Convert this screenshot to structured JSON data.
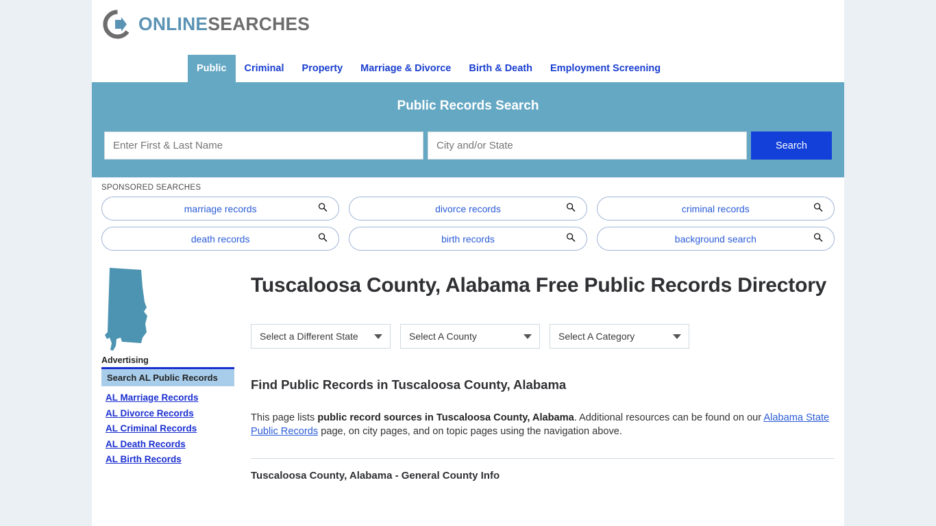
{
  "site": {
    "logo_online": "ONLINE",
    "logo_searches": "SEARCHES",
    "logo_icon": "circle-arrow-logo-icon"
  },
  "nav": {
    "items": [
      {
        "label": "Public",
        "active": true
      },
      {
        "label": "Criminal",
        "active": false
      },
      {
        "label": "Property",
        "active": false
      },
      {
        "label": "Marriage & Divorce",
        "active": false
      },
      {
        "label": "Birth & Death",
        "active": false
      },
      {
        "label": "Employment Screening",
        "active": false
      }
    ]
  },
  "hero": {
    "title": "Public Records Search",
    "name_placeholder": "Enter First & Last Name",
    "name_value": "",
    "location_placeholder": "City and/or State",
    "location_value": "",
    "search_button": "Search",
    "bg_color": "#65a8c3",
    "button_color": "#1240d9"
  },
  "sponsored": {
    "label": "SPONSORED SEARCHES",
    "rows": [
      [
        {
          "label": "marriage records",
          "icon": "search-icon"
        },
        {
          "label": "divorce records",
          "icon": "search-icon"
        },
        {
          "label": "criminal records",
          "icon": "search-icon"
        }
      ],
      [
        {
          "label": "death records",
          "icon": "search-icon"
        },
        {
          "label": "birth records",
          "icon": "search-icon"
        },
        {
          "label": "background search",
          "icon": "search-icon"
        }
      ]
    ]
  },
  "main": {
    "state_map_icon": "alabama-state-map-icon",
    "page_title": "Tuscaloosa County, Alabama Free Public Records Directory",
    "selects": {
      "state": "Select a Different State",
      "county": "Select A County",
      "category": "Select A Category"
    },
    "section_heading": "Find Public Records in Tuscaloosa County, Alabama",
    "paragraph": {
      "lead": "This page lists ",
      "bold": "public record sources in Tuscaloosa County, Alabama",
      "mid": ". Additional resources can be found on our ",
      "link": "Alabama State Public Records",
      "tail": " page, on city pages, and on topic pages using the navigation above."
    },
    "subsection_heading": "Tuscaloosa County, Alabama - General County Info"
  },
  "sidebar": {
    "advertising_label": "Advertising",
    "ad_heading": "Search AL Public Records",
    "links": [
      "AL Marriage Records",
      "AL Divorce Records",
      "AL Criminal Records",
      "AL Death Records",
      "AL Birth Records"
    ]
  }
}
